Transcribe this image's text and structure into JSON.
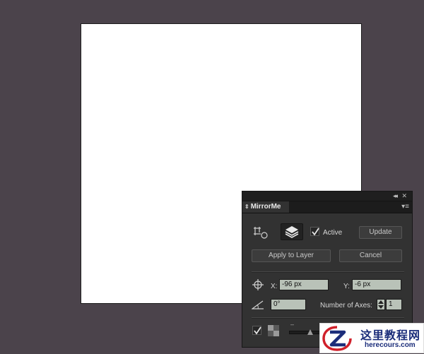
{
  "panel": {
    "tab_title": "MirrorMe",
    "collapse_glyph": "◂◂",
    "close_glyph": "✕",
    "menu_glyph": "▾≡",
    "tab_arrows_glyph": "⇕",
    "active_label": "Active",
    "active_checked": true,
    "update_label": "Update",
    "apply_label": "Apply to Layer",
    "cancel_label": "Cancel",
    "x_label": "X:",
    "x_value": "-96 px",
    "y_label": "Y:",
    "y_value": "-6 px",
    "angle_value": "0°",
    "axes_label": "Number of Axes:",
    "axes_value": "1",
    "bottom_checked": true,
    "slider_minus": "–",
    "icons": {
      "transform": "transform-icon",
      "layers": "layers-icon",
      "crosshair": "crosshair-icon",
      "angle": "angle-icon",
      "swatch": "swatch-icon"
    }
  },
  "colors": {
    "workspace_bg": "#4b434b",
    "panel_bg": "#323232",
    "field_bg": "#b9c2b8",
    "artboard": "#ffffff"
  },
  "watermark": {
    "cn_text": "这里教程网",
    "en_text": "herecours.com"
  }
}
